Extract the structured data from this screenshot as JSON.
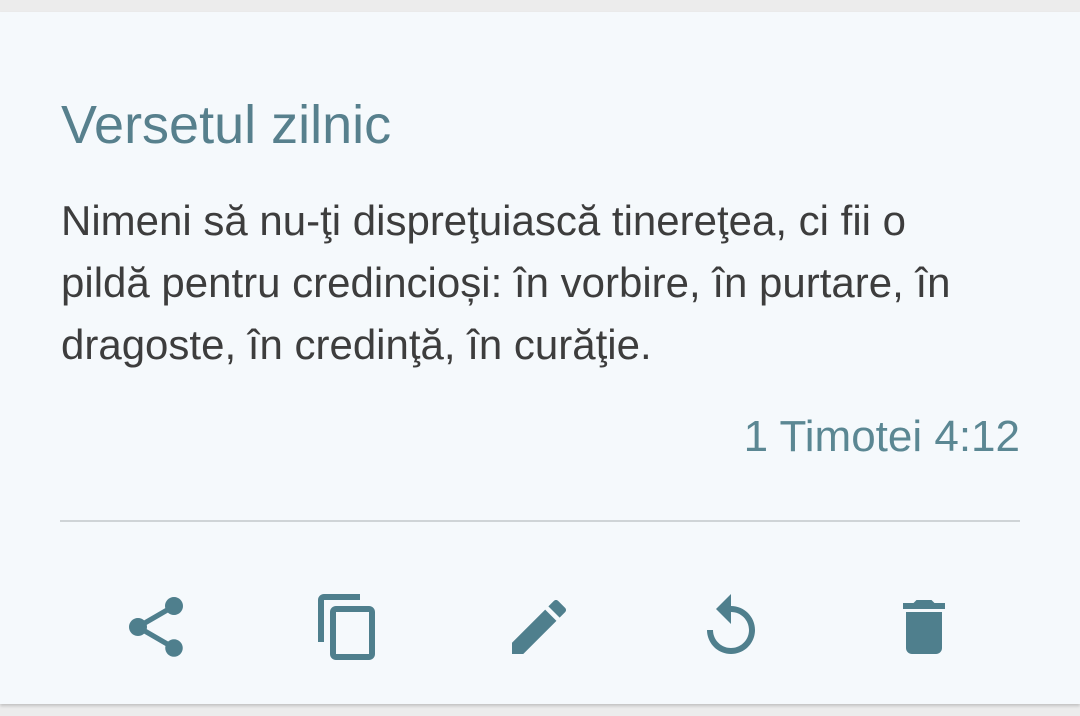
{
  "card": {
    "title": "Versetul zilnic",
    "verse_text": "Nimeni să nu-ţi dispreţuiască tinereţea, ci fii o pildă pentru credincioși: în vorbire, în purtare, în dragoste, în credinţă, în curăţie.",
    "reference": "1 Timotei 4:12"
  },
  "actions": [
    {
      "icon": "share-icon"
    },
    {
      "icon": "copy-icon"
    },
    {
      "icon": "edit-icon"
    },
    {
      "icon": "refresh-icon"
    },
    {
      "icon": "delete-icon"
    }
  ],
  "colors": {
    "accent": "#57808d",
    "text": "#3d3d3d",
    "background": "#f5f9fc",
    "divider": "#cfd4d7"
  }
}
